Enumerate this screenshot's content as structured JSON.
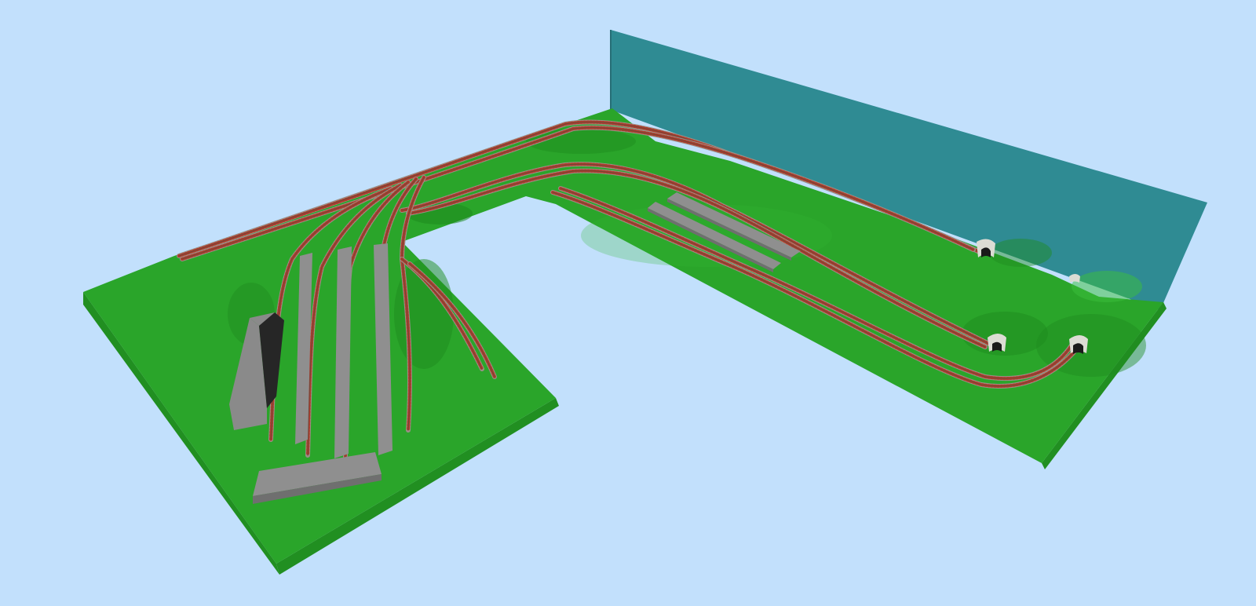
{
  "scene": {
    "subject": "3d-model-railway-layout-render",
    "colors": {
      "sky": "#c2e0fc",
      "grass": "#2aa52a",
      "grass_dark": "#1f8a1f",
      "grass_light": "#3cc23c",
      "board_edge": "#218f21",
      "backdrop": "#2f8b93",
      "backdrop_edge": "#276f77",
      "ballast": "#9a8f86",
      "rail": "#6d4a3c",
      "sleeper": "#b23a2a",
      "platform_top": "#8f8f8f",
      "platform_side": "#6f6f6f",
      "building_front": "#8a8a8a",
      "building_side": "#262626",
      "tunnel_portal": "#dcdcd4",
      "tunnel_mouth": "#1a1a1a"
    }
  }
}
